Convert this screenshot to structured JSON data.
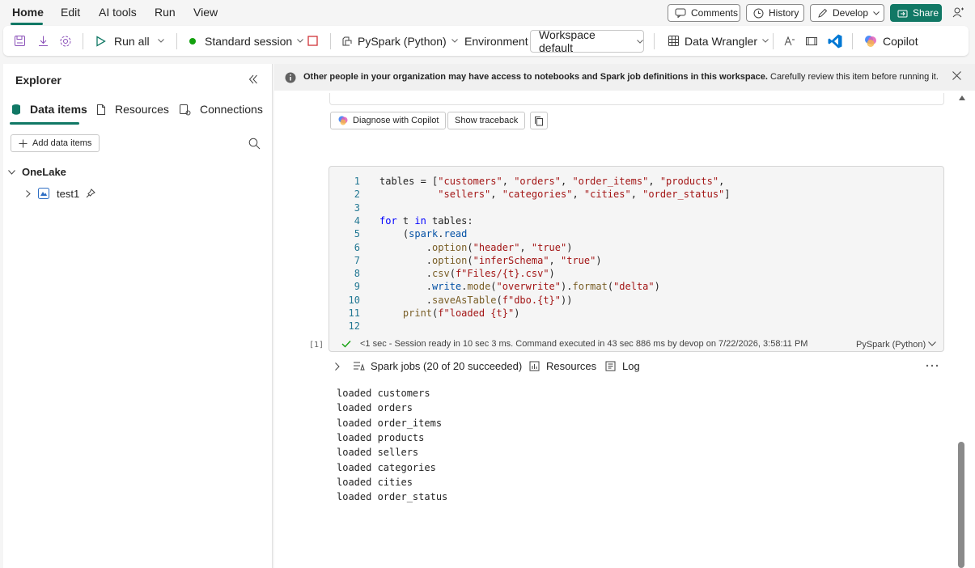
{
  "menu": {
    "items": [
      "Home",
      "Edit",
      "AI tools",
      "Run",
      "View"
    ]
  },
  "top_actions": {
    "comments": "Comments",
    "history": "History",
    "develop": "Develop",
    "share": "Share"
  },
  "toolbar": {
    "run_all": "Run all",
    "session": "Standard session",
    "language": "PySpark (Python)",
    "environment_label": "Environment",
    "environment_value": "Workspace default",
    "data_wrangler": "Data Wrangler",
    "copilot": "Copilot",
    "session_color": "#13a10e"
  },
  "explorer": {
    "title": "Explorer",
    "tabs": [
      "Data items",
      "Resources",
      "Connections"
    ],
    "add_button": "Add data items",
    "tree_root": "OneLake",
    "tree_items": [
      "test1"
    ]
  },
  "banner": {
    "bold_text": "Other people in your organization may have access to notebooks and Spark job definitions in this workspace.",
    "text": " Carefully review this item before running it."
  },
  "cell_buttons": {
    "diagnose": "Diagnose with Copilot",
    "traceback": "Show traceback"
  },
  "code": {
    "line_numbers": [
      "1",
      "2",
      "3",
      "4",
      "5",
      "6",
      "7",
      "8",
      "9",
      "10",
      "11",
      "12"
    ],
    "lines": [
      "tables = [\"customers\", \"orders\", \"order_items\", \"products\",",
      "          \"sellers\", \"categories\", \"cities\", \"order_status\"]",
      "",
      "for t in tables:",
      "    (spark.read",
      "        .option(\"header\", \"true\")",
      "        .option(\"inferSchema\", \"true\")",
      "        .csv(f\"Files/{t}.csv\")",
      "        .write.mode(\"overwrite\").format(\"delta\")",
      "        .saveAsTable(f\"dbo.{t}\"))",
      "    print(f\"loaded {t}\")",
      ""
    ]
  },
  "execution": {
    "count": "[1]",
    "status": "<1 sec - Session ready in 10 sec 3 ms. Command executed in 43 sec 886 ms by devop on 7/22/2026, 3:58:11 PM",
    "language": "PySpark (Python)"
  },
  "spark": {
    "jobs": "Spark jobs (20 of 20 succeeded)",
    "resources": "Resources",
    "log": "Log"
  },
  "output": {
    "lines": [
      "loaded customers",
      "loaded orders",
      "loaded order_items",
      "loaded products",
      "loaded sellers",
      "loaded categories",
      "loaded cities",
      "loaded order_status"
    ]
  }
}
